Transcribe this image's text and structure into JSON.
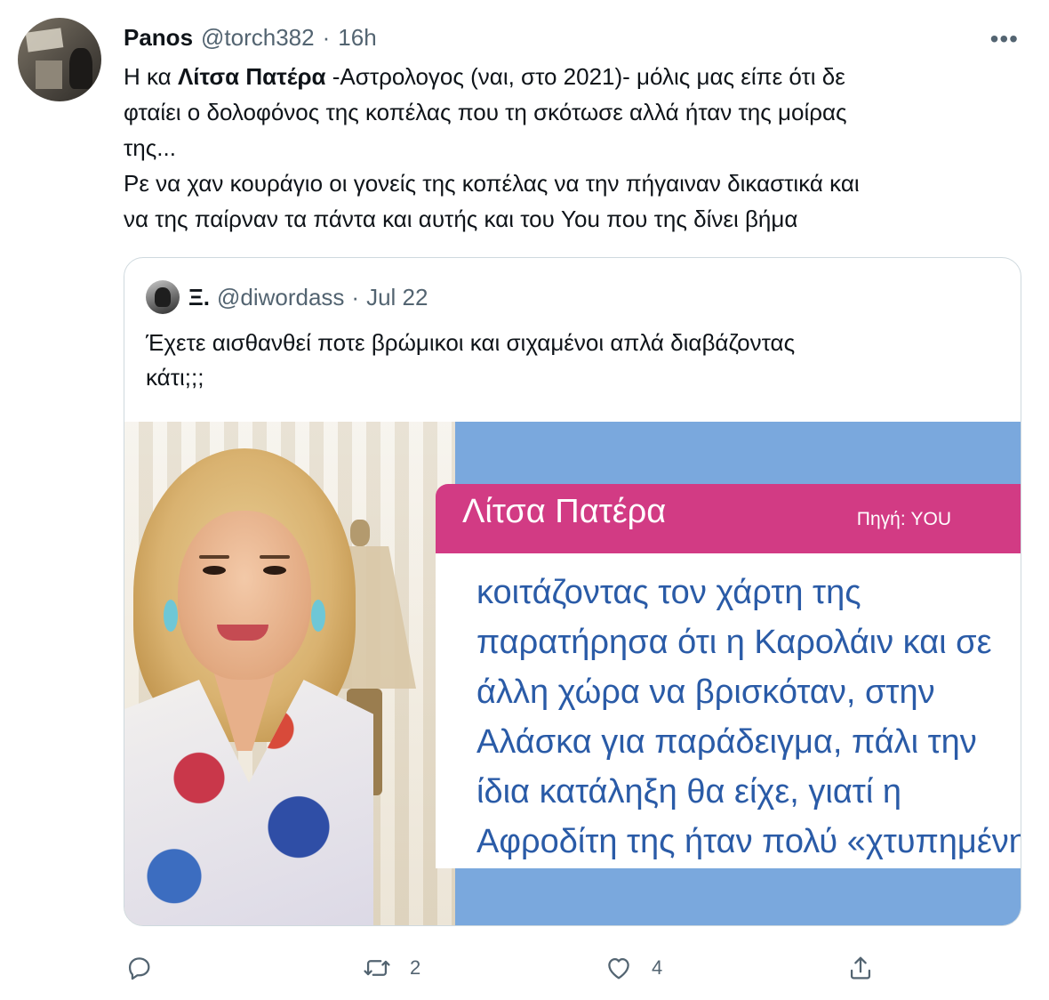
{
  "tweet": {
    "author_name": "Panos",
    "author_handle": "@torch382",
    "separator": "·",
    "time": "16h",
    "more": "•••",
    "text": {
      "l1_pre": "Η κα ",
      "l1_bold": "Λίτσα Πατέρα",
      "l1_post": " -Αστρολογος (ναι, στο 2021)- μόλις μας είπε ότι δε",
      "l2": "φταίει ο δολοφόνος της κοπέλας που τη σκότωσε αλλά ήταν της μοίρας",
      "l3": "της...",
      "l4": "Ρε να χαν κουράγιο οι γονείς της κοπέλας να την πήγαιναν δικαστικά και",
      "l5": "να της παίρναν τα πάντα και αυτής και του You που της δίνει βήμα"
    }
  },
  "quote": {
    "author_name": "Ξ.",
    "author_handle": "@diwordass",
    "separator": "·",
    "date": "Jul 22",
    "text": {
      "l1": "Έχετε αισθανθεί ποτε βρώμικοι και σιχαμένοι απλά διαβάζοντας",
      "l2": "κάτι;;;"
    },
    "media": {
      "banner_name": "Λίτσα Πατέρα",
      "banner_source": "Πηγή: YOU",
      "quote_lines": [
        "κοιτάζοντας τον χάρτη της",
        "παρατήρησα ότι η Καρολάιν και σε",
        "άλλη χώρα να βρισκόταν, στην",
        "Αλάσκα για παράδειγμα, πάλι την",
        "ίδια κατάληξη θα είχε, γιατί η",
        "Αφροδίτη της ήταν πολύ «χτυπημένη»."
      ],
      "colors": {
        "banner": "#d23b84",
        "panel": "#6c9fd8",
        "text": "#2a5ba7"
      }
    }
  },
  "actions": {
    "reply_icon": "reply-icon",
    "retweet_icon": "retweet-icon",
    "retweet_count": "2",
    "like_icon": "heart-icon",
    "like_count": "4",
    "share_icon": "share-icon"
  }
}
